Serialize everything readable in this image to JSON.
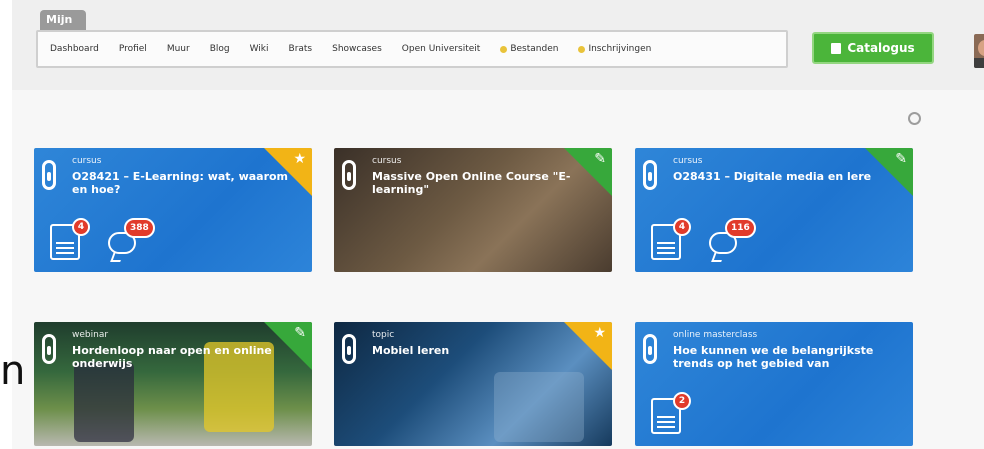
{
  "topbar": {
    "tab_label": "Mijn",
    "nav": [
      {
        "label": "Dashboard"
      },
      {
        "label": "Profiel"
      },
      {
        "label": "Muur"
      },
      {
        "label": "Blog"
      },
      {
        "label": "Wiki"
      },
      {
        "label": "Brats"
      },
      {
        "label": "Showcases"
      },
      {
        "label": "Open Universiteit"
      },
      {
        "label": "Bestanden",
        "icon": "yellow-dot-icon"
      },
      {
        "label": "Inschrijvingen",
        "icon": "yellow-dot-icon"
      }
    ],
    "catalogus_label": "Catalogus",
    "avatar": "user-avatar"
  },
  "edge_text": "n",
  "cards": [
    {
      "type": "cursus",
      "title": "O28421 – E-Learning: wat, waarom en hoe?",
      "corner": "star-icon",
      "corner_color": "#f2b416",
      "news_count": "4",
      "comment_count": "388"
    },
    {
      "type": "cursus",
      "title": "Massive Open Online Course \"E-learning\"",
      "corner": "pencil-icon",
      "corner_color": "#37a83b"
    },
    {
      "type": "cursus",
      "title": "O28431 – Digitale media en lere",
      "corner": "pencil-icon",
      "corner_color": "#37a83b",
      "news_count": "4",
      "comment_count": "116"
    },
    {
      "type": "webinar",
      "title": "Hordenloop naar open en online onderwijs",
      "corner": "pencil-icon",
      "corner_color": "#37a83b"
    },
    {
      "type": "topic",
      "title": "Mobiel leren",
      "corner": "star-icon",
      "corner_color": "#f2b416"
    },
    {
      "type": "online masterclass",
      "title": "Hoe kunnen we de belangrijkste trends op het gebied van",
      "news_count": "2"
    }
  ]
}
